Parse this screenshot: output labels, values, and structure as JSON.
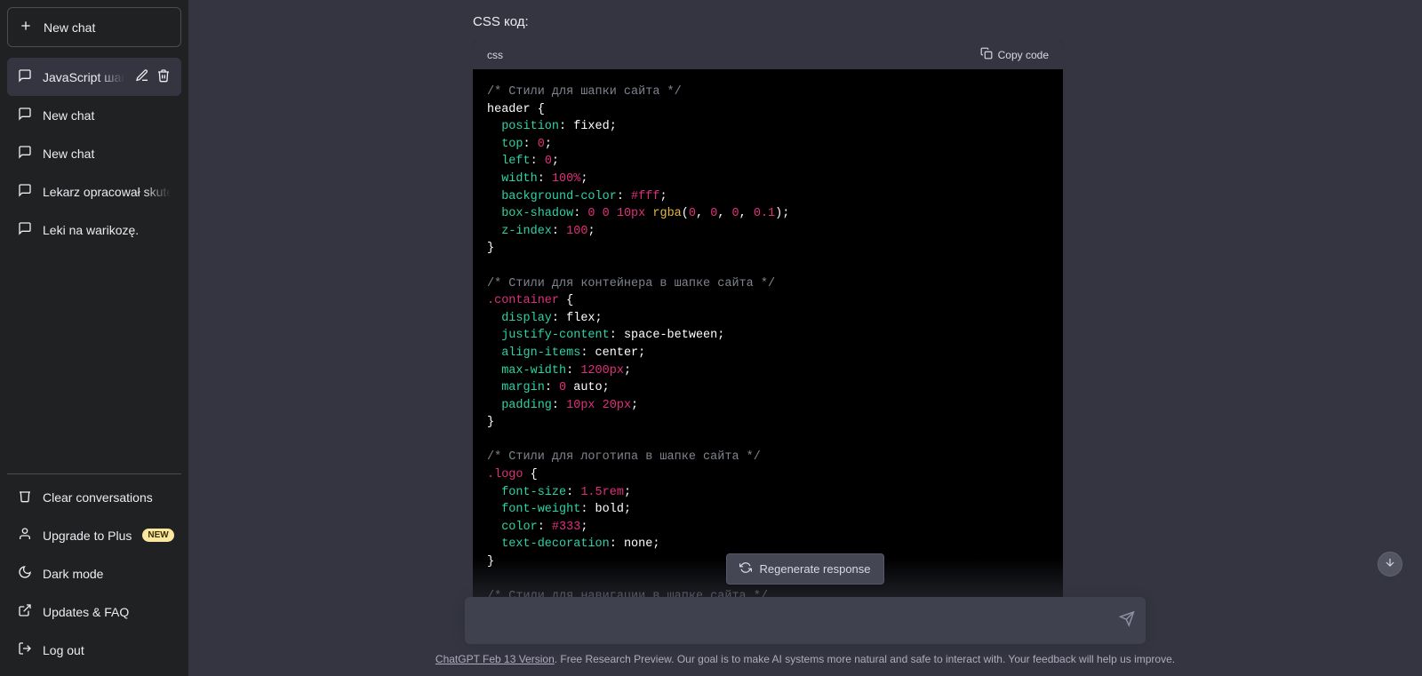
{
  "sidebar": {
    "new_chat_label": "New chat",
    "items": [
      {
        "label": "JavaScript шапка сай",
        "active": true
      },
      {
        "label": "New chat",
        "active": false
      },
      {
        "label": "New chat",
        "active": false
      },
      {
        "label": "Lekarz opracował skuteczny",
        "active": false
      },
      {
        "label": "Leki na warikozę.",
        "active": false
      }
    ],
    "bottom": {
      "clear": "Clear conversations",
      "upgrade": "Upgrade to Plus",
      "upgrade_badge": "NEW",
      "dark": "Dark mode",
      "faq": "Updates & FAQ",
      "logout": "Log out"
    }
  },
  "main": {
    "intro": "CSS код:",
    "codeblock": {
      "lang": "css",
      "copy_label": "Copy code"
    },
    "regenerate": "Regenerate response",
    "footer_version": "ChatGPT Feb 13 Version",
    "footer_rest": ". Free Research Preview. Our goal is to make AI systems more natural and safe to interact with. Your feedback will help us improve."
  },
  "code": {
    "c1": "/* Стили для шапки сайта */",
    "sel_header": "header {",
    "p_position": "position",
    "v_fixed": " fixed",
    "p_top": "top",
    "v_top": "0",
    "p_left": "left",
    "v_left": "0",
    "p_width": "width",
    "v_width": "100%",
    "p_bg": "background-color",
    "v_bg": "#fff",
    "p_bs": "box-shadow",
    "v_bs1": "0",
    "v_bs2": "0",
    "v_bs3": "10px",
    "v_rgba": "rgba",
    "v_r": "0",
    "v_g": "0",
    "v_b": "0",
    "v_a": "0.1",
    "p_zi": "z-index",
    "v_zi": "100",
    "brace_close": "}",
    "c2": "/* Стили для контейнера в шапке сайта */",
    "sel_container": ".container",
    "open_brace": " {",
    "p_display": "display",
    "v_flex": " flex",
    "p_jc": "justify-content",
    "v_jc": " space-between",
    "p_ai": "align-items",
    "v_ai": " center",
    "p_mw": "max-width",
    "v_mw": "1200px",
    "p_margin": "margin",
    "v_margin_0": "0",
    "v_margin_auto": " auto",
    "p_padding": "padding",
    "v_pad1": "10px",
    "v_pad2": "20px",
    "c3": "/* Стили для логотипа в шапке сайта */",
    "sel_logo": ".logo",
    "p_fs": "font-size",
    "v_fs": "1.5rem",
    "p_fw": "font-weight",
    "v_fw": " bold",
    "p_color": "color",
    "v_color": "#333",
    "p_td": "text-decoration",
    "v_td": " none",
    "c4": "/* Стили для навигации в шапке сайта */"
  }
}
